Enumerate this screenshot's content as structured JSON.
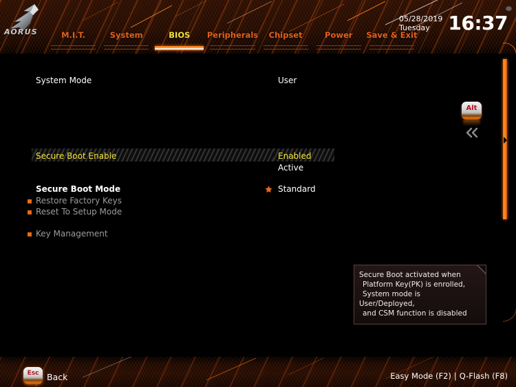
{
  "header": {
    "logo_text": "AORUS",
    "logo_icon": "aorus-eagle-logo",
    "gear_icon": "gear-icon",
    "date": "05/28/2019",
    "weekday": "Tuesday",
    "time": "16:37",
    "tabs": [
      {
        "label": "M.I.T.",
        "active": false
      },
      {
        "label": "System",
        "active": false
      },
      {
        "label": "BIOS",
        "active": true
      },
      {
        "label": "Peripherals",
        "active": false
      },
      {
        "label": "Chipset",
        "active": false
      },
      {
        "label": "Power",
        "active": false
      },
      {
        "label": "Save & Exit",
        "active": false
      }
    ]
  },
  "settings": {
    "rows": [
      {
        "label": "System Mode",
        "value": "User"
      },
      {
        "label": "Secure Boot Enable",
        "value": "Enabled"
      },
      {
        "label": "",
        "value": "Active"
      },
      {
        "label": "Secure Boot Mode",
        "value": "Standard"
      }
    ],
    "menu_items": [
      {
        "label": "Restore Factory Keys"
      },
      {
        "label": "Reset To Setup Mode"
      },
      {
        "label": "Key Management"
      }
    ],
    "star_icon": "star-icon"
  },
  "tooltip": {
    "lines": [
      "Secure Boot activated when",
      "Platform Key(PK) is enrolled,",
      "System mode is",
      "User/Deployed,",
      "and CSM function is disabled"
    ]
  },
  "side_widgets": {
    "alt_key_label": "Alt",
    "collapse_icon": "double-chevron-left-icon",
    "scrollbar_icon": "scroll-indicator-arrow-icon"
  },
  "footer": {
    "esc_key_label": "Esc",
    "back_label": "Back",
    "easy_mode": "Easy Mode (F2)",
    "separator": "|",
    "q_flash": "Q-Flash (F8)"
  },
  "colors": {
    "accent_orange": "#e8681a",
    "highlight_yellow": "#f2e23c",
    "text_white": "#ffffff",
    "text_grey": "#9c9c9c",
    "background": "#000000"
  }
}
